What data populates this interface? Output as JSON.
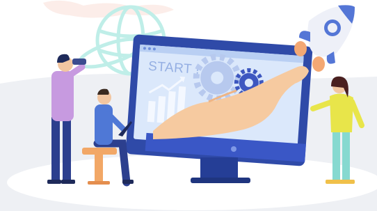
{
  "illustration": {
    "monitor_label": "START !",
    "colors": {
      "background_panel": "#eef0f4",
      "monitor_frame": "#2f4aa8",
      "screen": "#dbe8fb",
      "hand": "#f6caa0",
      "globe": "#bfeee8",
      "rocket_body": "#eef0f8",
      "rocket_accent": "#5476d6",
      "flame": "#f3a874",
      "gear": "#b7c9ee",
      "gear_dark": "#3d57c0"
    },
    "figures": [
      "man-with-binoculars",
      "man-with-laptop",
      "woman-presenting"
    ]
  }
}
